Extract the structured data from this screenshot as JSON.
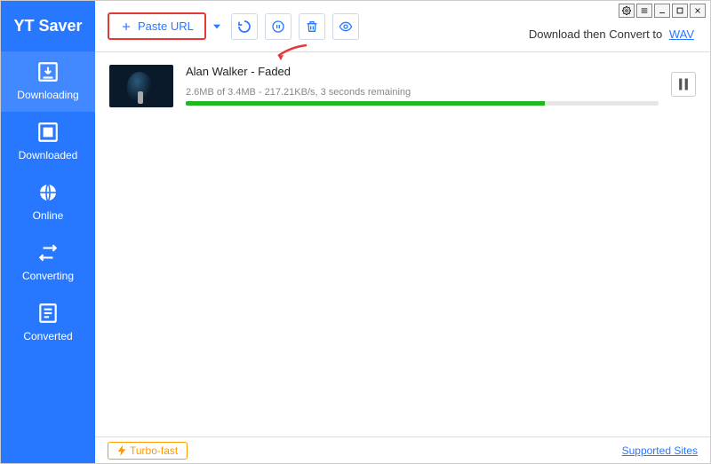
{
  "app": {
    "title": "YT Saver"
  },
  "titlebar": {
    "buttons": [
      "settings",
      "menu",
      "minimize",
      "maximize",
      "close"
    ]
  },
  "sidebar": {
    "items": [
      {
        "id": "downloading",
        "label": "Downloading"
      },
      {
        "id": "downloaded",
        "label": "Downloaded"
      },
      {
        "id": "online",
        "label": "Online"
      },
      {
        "id": "converting",
        "label": "Converting"
      },
      {
        "id": "converted",
        "label": "Converted"
      }
    ]
  },
  "toolbar": {
    "paste_label": "Paste URL",
    "convert_text": "Download then Convert to",
    "convert_format": "WAV"
  },
  "download": {
    "title": "Alan Walker - Faded",
    "meta": "2.6MB of 3.4MB - 217.21KB/s, 3 seconds remaining",
    "progress_pct": 76
  },
  "footer": {
    "turbo_label": "Turbo-fast",
    "supported_label": "Supported Sites"
  }
}
